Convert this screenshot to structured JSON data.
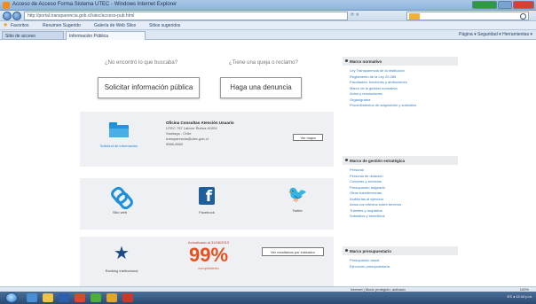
{
  "browser": {
    "window_title": "Acceso de Acceso Forma Sistema UTEC - Windows Internet Explorer",
    "url": "http://portal.transparencia.gob.cl/utec/acceso-pub.html",
    "search_placeholder": "Bing",
    "favorites": [
      "Favoritos",
      "Resumen Sugerido",
      "Galería de Web Slice",
      "Sitios sugeridos"
    ],
    "tabs": [
      "Sitio de acceso",
      "Información Pública"
    ],
    "command_bar": "Página ▾  Seguridad ▾  Herramientas ▾",
    "status_zone": "Internet | Modo protegido: activado",
    "zoom": "100%"
  },
  "main": {
    "question_left": "¿No encontró lo que buscaba?",
    "question_right": "¿Tiene una queja o reclamo?",
    "btn_solicitar": "Solicitar información pública",
    "btn_denuncia": "Haga una denuncia",
    "folder_caption": "Solicitud de información",
    "contact": {
      "name": "Oficina Consultas Atención Usuario",
      "line1": "UTEC 757 Latorre Ñuñoa #1004",
      "line2": "Santiago - Chile",
      "line3": "transparencia@utec.gob.cl",
      "line4": "5566-6660"
    },
    "contact_button": "Ver mapa",
    "social": {
      "web_caption": "Sitio web",
      "facebook_caption": "Facebook",
      "twitter_caption": "Twitter",
      "facebook_letter": "f",
      "twitter_glyph": "🐦"
    },
    "rating_caption": "Ranking institucional",
    "percent_label": "Actualizado al 31/08/2013",
    "percent_value": "99%",
    "percent_sub": "cumplimiento",
    "percent_button": "Ver resultados por indicador"
  },
  "sidebar": {
    "sections": [
      {
        "title": "Marco normativo",
        "items": [
          "Ley Transparencia de la Institución",
          "Reglamento de la Ley 20.285",
          "Facultades, funciones y atribuciones",
          "Marco de la gestión normativa",
          "Actos y resoluciones",
          "Organigrama",
          "Procedimientos de adquisición y subsidios"
        ]
      },
      {
        "title": "Marco de gestión estratégica",
        "items": [
          "Personal",
          "Personal de dotación",
          "Compras y servicios",
          "Presupuesto asignado",
          "Otras transferencias",
          "Auditorías al ejercicio",
          "Actos con efectos sobre terceros",
          "Trámites y requisitos",
          "Subsidios y beneficios"
        ]
      },
      {
        "title": "Marco presupuestario",
        "items": [
          "Presupuesto anual",
          "Ejecución presupuestaria"
        ]
      }
    ]
  },
  "taskbar": {
    "clock": "ES  ◂  12:44 p.m."
  },
  "colors": {
    "accent_blue": "#1d8fdd",
    "orange": "#e8501d",
    "navy_star": "#1b4a86"
  }
}
